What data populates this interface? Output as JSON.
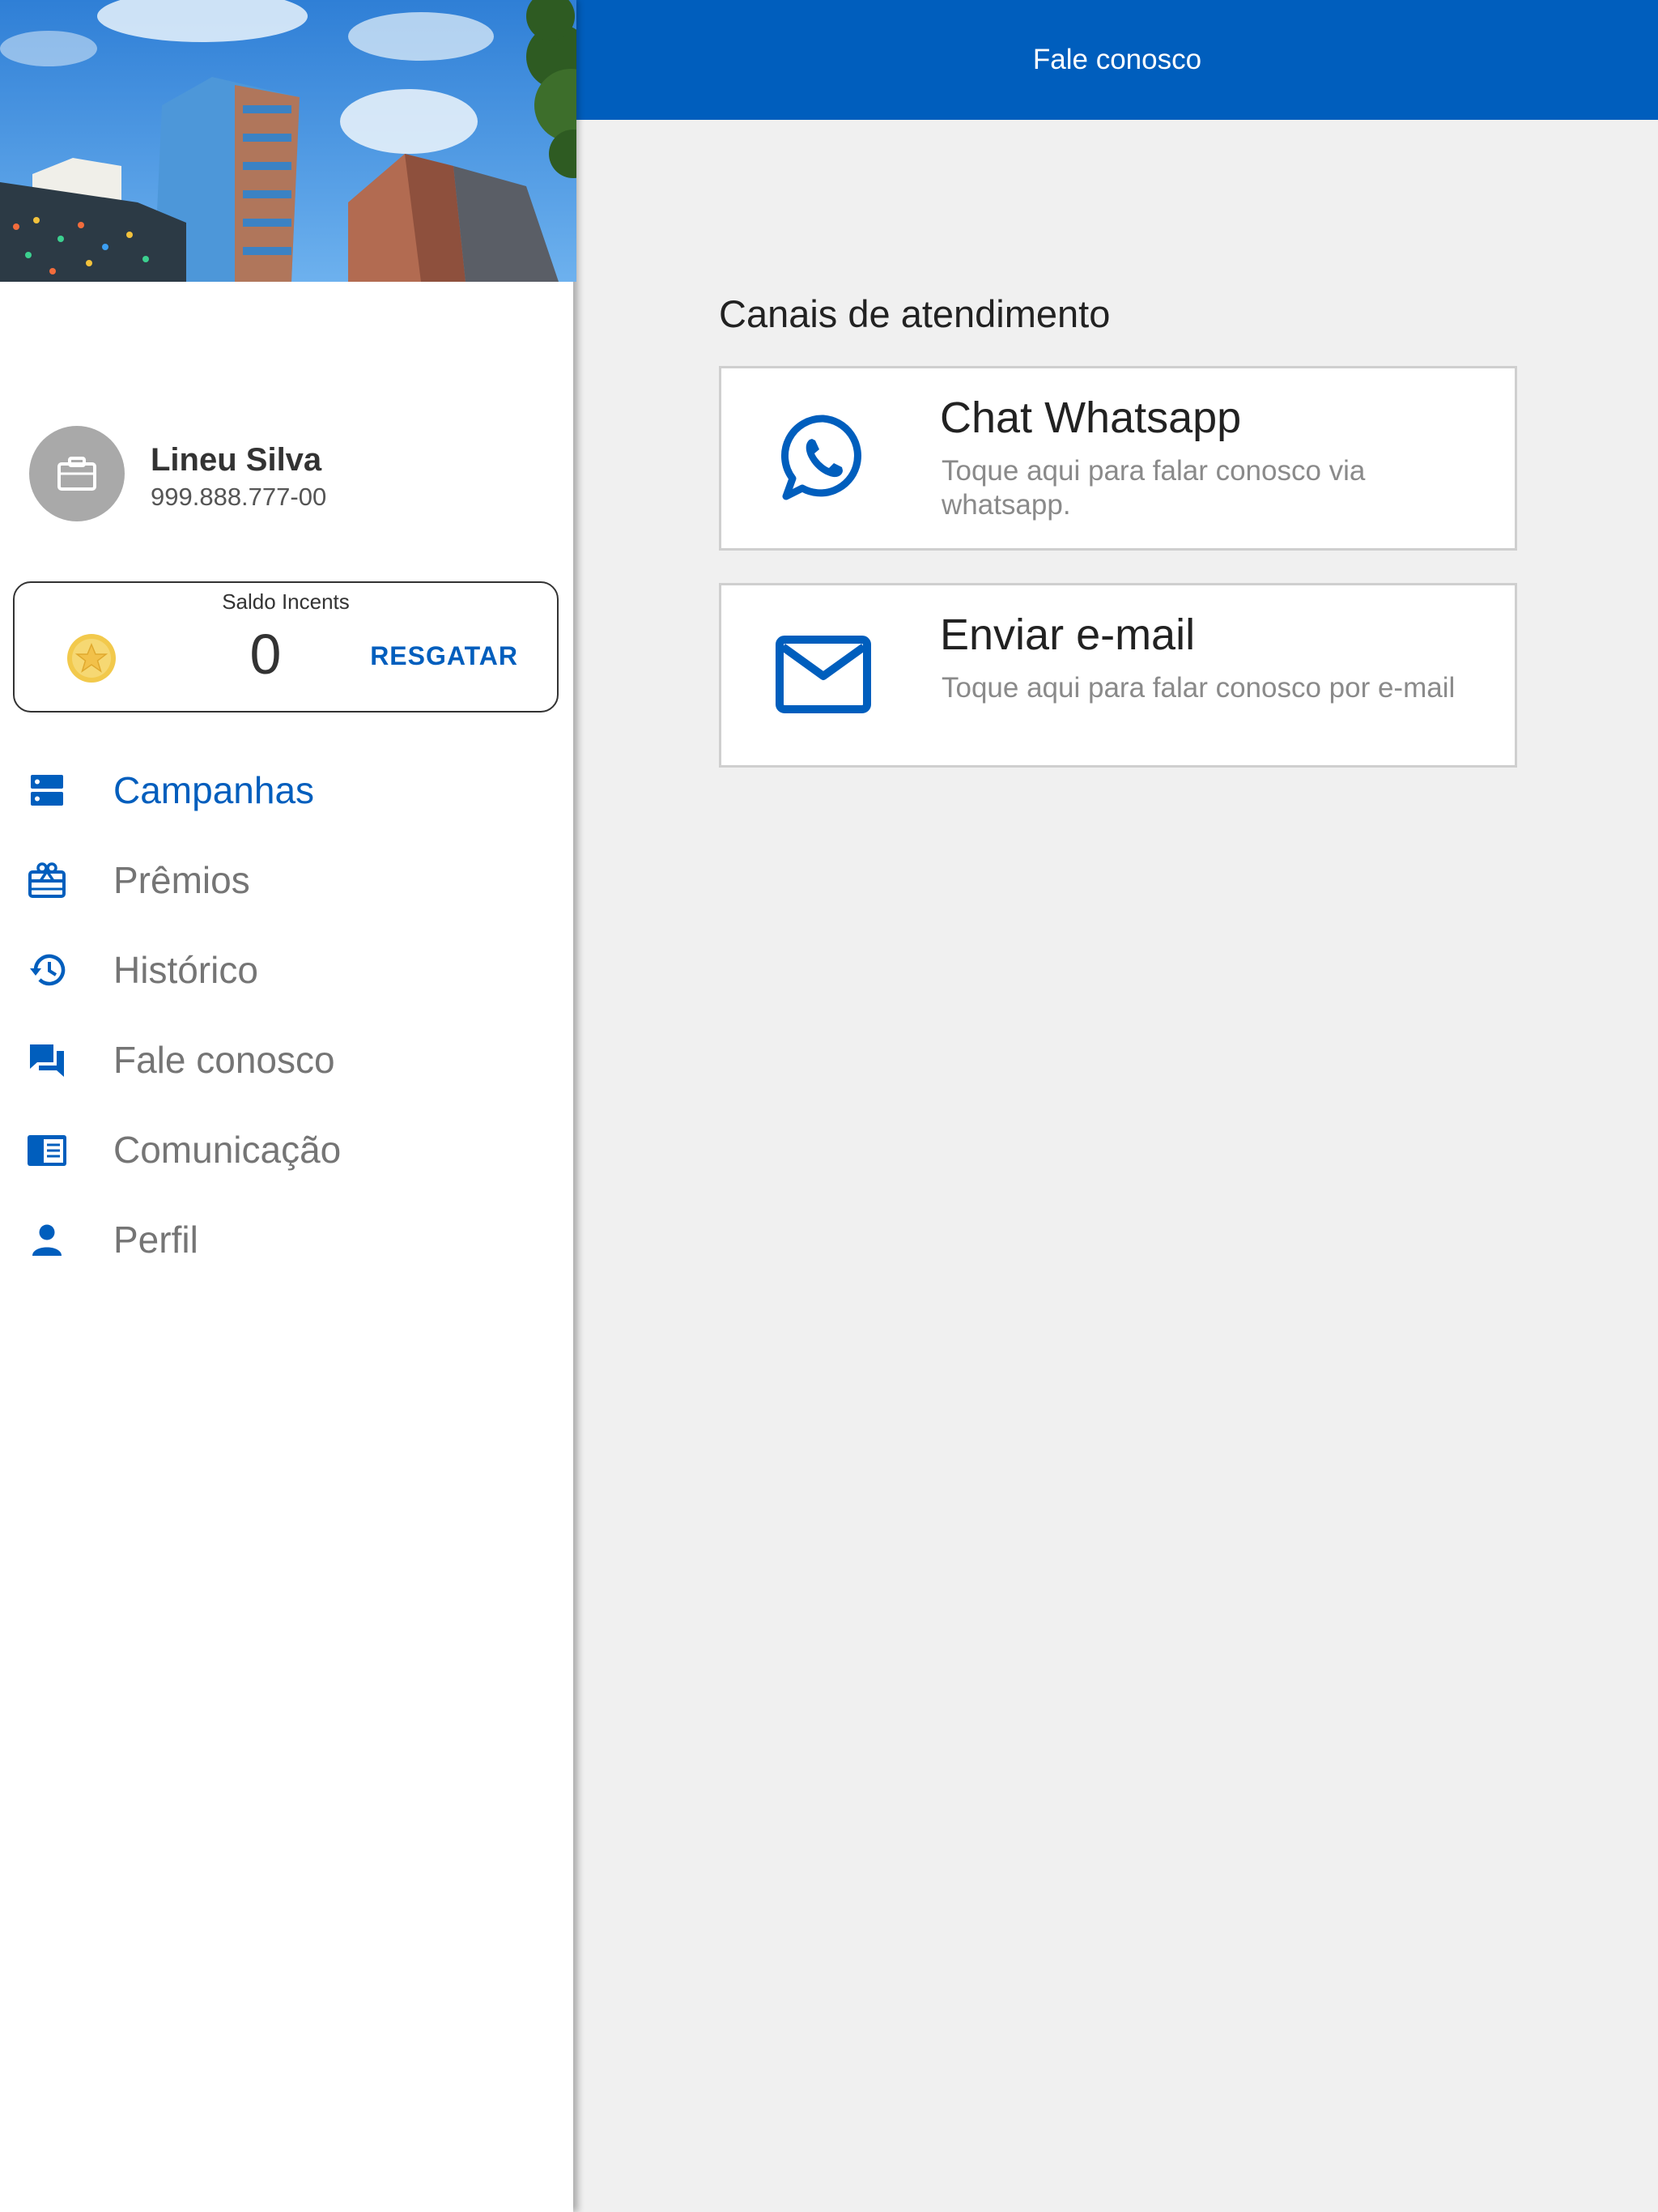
{
  "header": {
    "title": "Fale conosco"
  },
  "user": {
    "name": "Lineu Silva",
    "document": "999.888.777-00"
  },
  "balance": {
    "label": "Saldo Incents",
    "value": "0",
    "redeem_label": "RESGATAR"
  },
  "menu": {
    "items": [
      {
        "label": "Campanhas",
        "icon": "campaigns-icon",
        "active": true
      },
      {
        "label": "Prêmios",
        "icon": "gift-card-icon",
        "active": false
      },
      {
        "label": "Histórico",
        "icon": "history-icon",
        "active": false
      },
      {
        "label": "Fale conosco",
        "icon": "chat-bubbles-icon",
        "active": false
      },
      {
        "label": "Comunicação",
        "icon": "newspaper-icon",
        "active": false
      },
      {
        "label": "Perfil",
        "icon": "person-icon",
        "active": false
      }
    ]
  },
  "main": {
    "section_title": "Canais de atendimento",
    "channels": [
      {
        "title": "Chat Whatsapp",
        "description": "Toque aqui para falar conosco via whatsapp.",
        "icon": "whatsapp-icon"
      },
      {
        "title": "Enviar e-mail",
        "description": "Toque aqui para falar conosco por e-mail",
        "icon": "mail-icon"
      }
    ]
  },
  "colors": {
    "primary": "#005ebd",
    "menu_text": "#757575",
    "background": "#f0f0f0",
    "card_border": "#cfcfcf"
  }
}
